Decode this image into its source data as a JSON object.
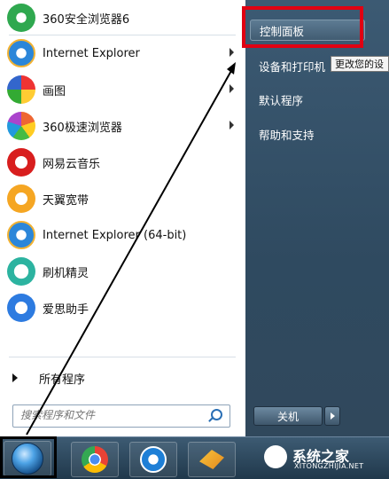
{
  "programs": [
    {
      "label": "360安全浏览器6",
      "icon": "360-safe-browser-icon",
      "has_submenu": false
    },
    {
      "label": "Internet Explorer",
      "icon": "internet-explorer-icon",
      "has_submenu": true
    },
    {
      "label": "画图",
      "icon": "paint-icon",
      "has_submenu": true
    },
    {
      "label": "360极速浏览器",
      "icon": "360-speed-browser-icon",
      "has_submenu": true
    },
    {
      "label": "网易云音乐",
      "icon": "netease-music-icon",
      "has_submenu": false
    },
    {
      "label": "天翼宽带",
      "icon": "tianyi-broadband-icon",
      "has_submenu": false
    },
    {
      "label": "Internet Explorer (64-bit)",
      "icon": "internet-explorer-icon",
      "has_submenu": false
    },
    {
      "label": "刷机精灵",
      "icon": "shuaji-jingling-icon",
      "has_submenu": false
    },
    {
      "label": "爱思助手",
      "icon": "aisi-assistant-icon",
      "has_submenu": false
    }
  ],
  "all_programs": "所有程序",
  "search": {
    "placeholder": "搜索程序和文件"
  },
  "right_items": [
    "控制面板",
    "设备和打印机",
    "默认程序",
    "帮助和支持"
  ],
  "tooltip": "更改您的设",
  "shutdown_label": "关机",
  "watermark": {
    "title": "系统之家",
    "sub": "XITONGZHIJIA.NET"
  },
  "colors": {
    "highlight_box": "#e00012",
    "accent": "#2a6fb5"
  }
}
